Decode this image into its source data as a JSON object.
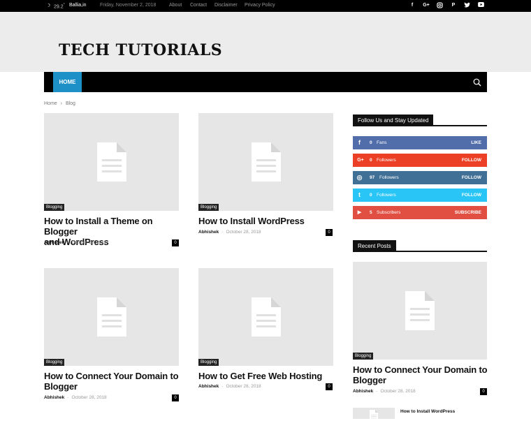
{
  "topbar": {
    "weather_temp": "29.2",
    "weather_unit": "°",
    "weather_city": "Ballia,in",
    "date": "Friday, November 2, 2018",
    "links": [
      "About",
      "Contact",
      "Disclaimer",
      "Privacy Policy"
    ],
    "social_icons": [
      "facebook-icon",
      "google-plus-icon",
      "instagram-icon",
      "pinterest-icon",
      "twitter-icon",
      "youtube-icon"
    ]
  },
  "header": {
    "logo_text": "TECH TUTORIALS"
  },
  "nav": {
    "home_label": "HOME"
  },
  "breadcrumb": {
    "home": "Home",
    "separator": "›",
    "current": "Blog"
  },
  "posts": [
    {
      "category": "Blogging",
      "title_line1": "How to Install a Theme on Blogger",
      "title_line2": "and WordPress",
      "author": "Abhishek",
      "separator": "-",
      "date": "October 28, 2018",
      "comments": "0"
    },
    {
      "category": "Blogging",
      "title_line1": "How to Install WordPress",
      "title_line2": "",
      "author": "Abhishek",
      "separator": "-",
      "date": "October 28, 2018",
      "comments": "0"
    },
    {
      "category": "Blogging",
      "title_line1": "How to Connect Your Domain to",
      "title_line2": "Blogger",
      "author": "Abhishek",
      "separator": "-",
      "date": "October 28, 2018",
      "comments": "0"
    },
    {
      "category": "Blogging",
      "title_line1": "How to Get Free Web Hosting",
      "title_line2": "",
      "author": "Abhishek",
      "separator": "-",
      "date": "October 28, 2018",
      "comments": "0"
    }
  ],
  "sidebar": {
    "follow_title": "Follow Us and Stay Updated",
    "social": [
      {
        "icon": "facebook-icon",
        "glyph": "f",
        "count": "0",
        "label": "Fans",
        "action": "LIKE",
        "color": "#516eab"
      },
      {
        "icon": "google-plus-icon",
        "glyph": "G+",
        "count": "0",
        "label": "Followers",
        "action": "FOLLOW",
        "color": "#eb4026"
      },
      {
        "icon": "instagram-icon",
        "glyph": "◎",
        "count": "97",
        "label": "Followers",
        "action": "FOLLOW",
        "color": "#417096"
      },
      {
        "icon": "twitter-icon",
        "glyph": "t",
        "count": "0",
        "label": "Followers",
        "action": "FOLLOW",
        "color": "#29c5f6"
      },
      {
        "icon": "youtube-icon",
        "glyph": "▶",
        "count": "5",
        "label": "Subscribers",
        "action": "SUBSCRIBE",
        "color": "#e14e42"
      }
    ],
    "recent_title": "Recent Posts",
    "recent_main": {
      "category": "Blogging",
      "title_line1": "How to Connect Your Domain to",
      "title_line2": "Blogger",
      "author": "Abhishek",
      "separator": "-",
      "date": "October 28, 2018",
      "comments": "0"
    },
    "recent_small": {
      "title": "How to Install WordPress"
    }
  }
}
